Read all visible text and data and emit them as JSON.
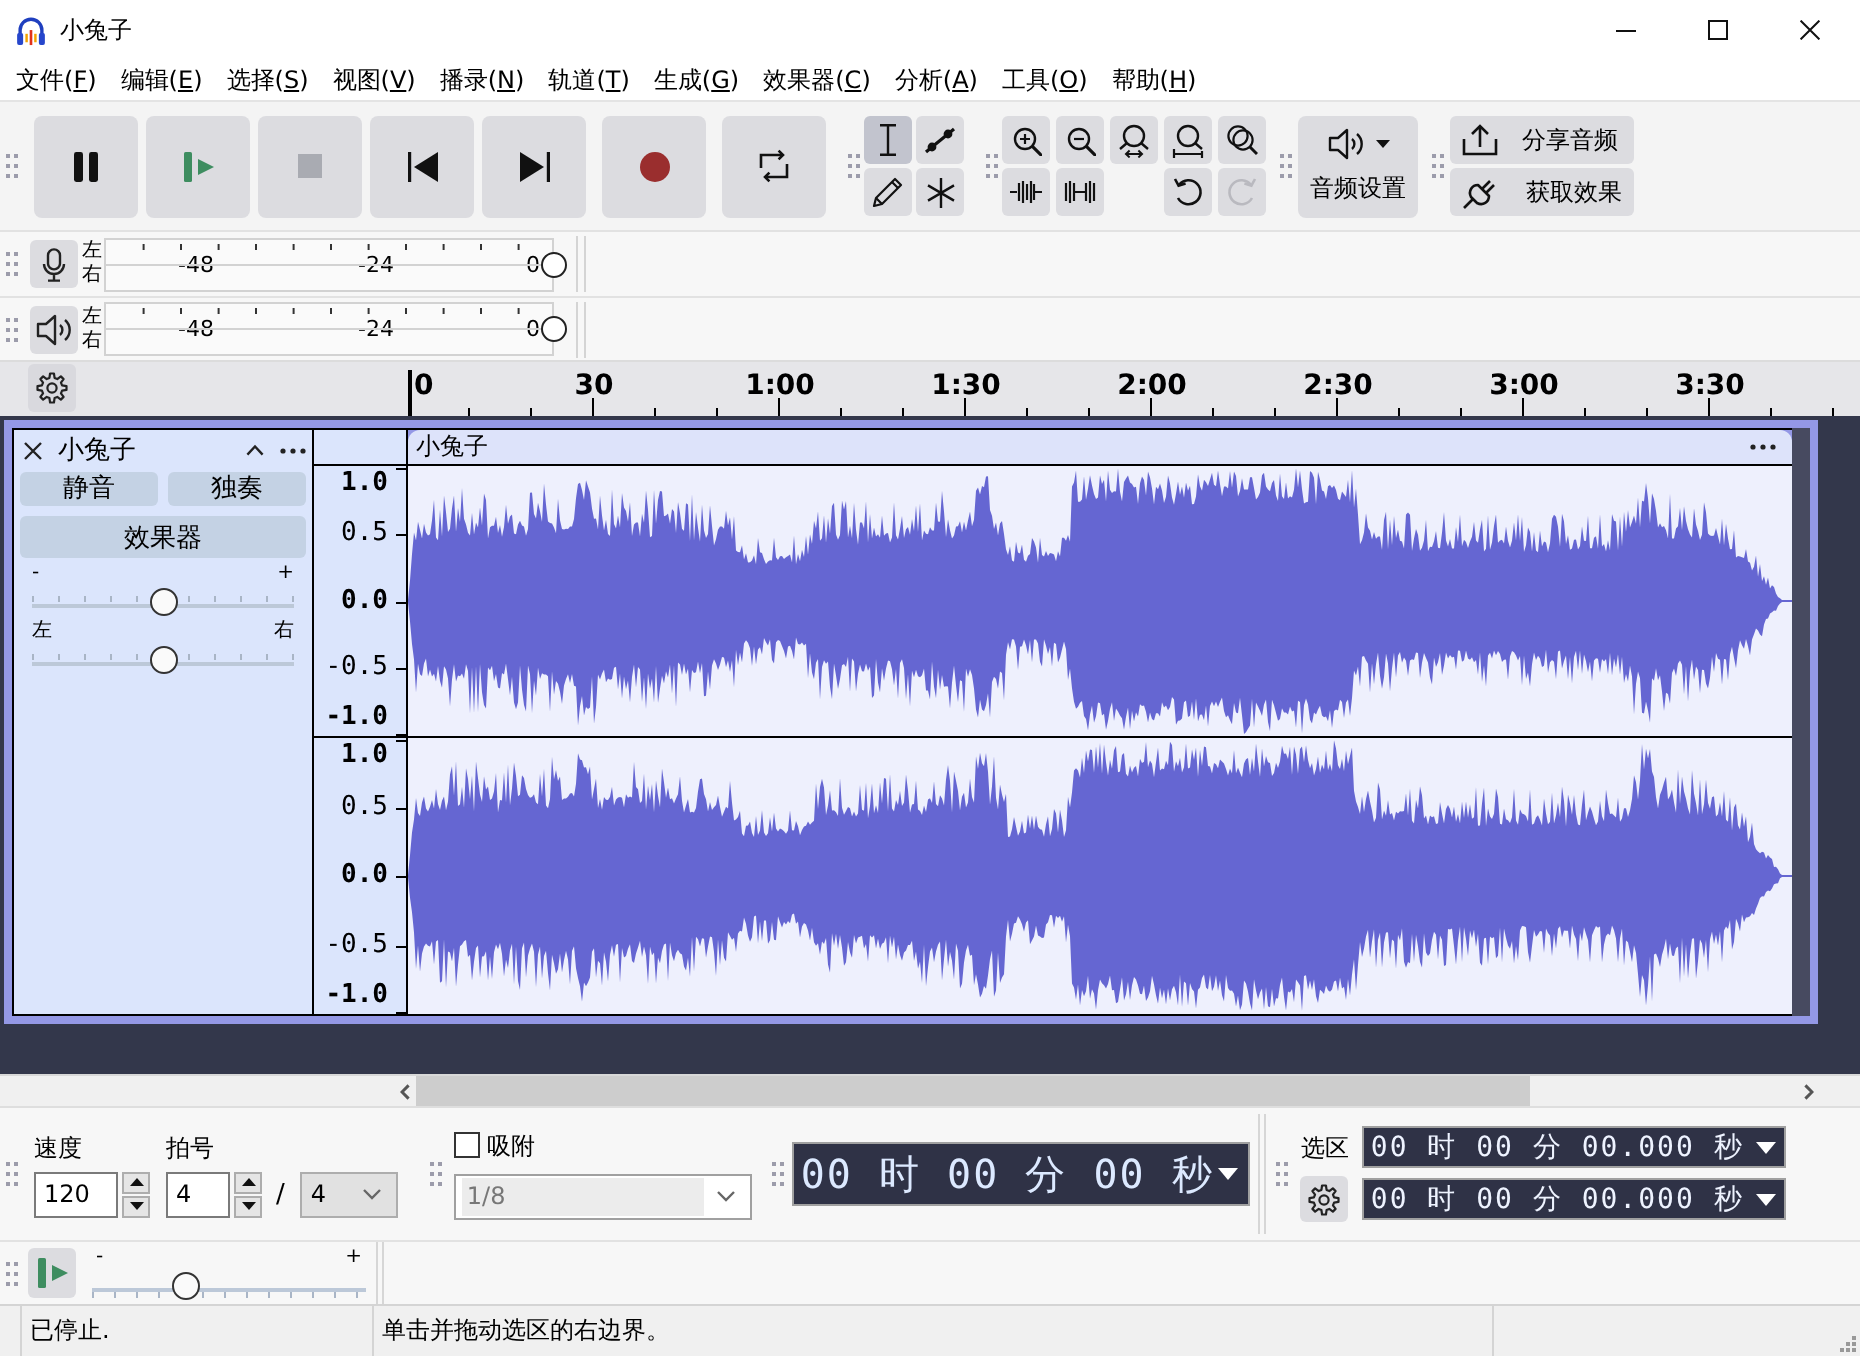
{
  "window": {
    "title": "小兔子"
  },
  "menu": [
    "文件(F)",
    "编辑(E)",
    "选择(S)",
    "视图(V)",
    "播录(N)",
    "轨道(T)",
    "生成(G)",
    "效果器(C)",
    "分析(A)",
    "工具(O)",
    "帮助(H)"
  ],
  "transport": [
    {
      "kind": "pause",
      "disabled": false
    },
    {
      "kind": "play",
      "disabled": false
    },
    {
      "kind": "stop",
      "disabled": true
    },
    {
      "kind": "skip_to_start",
      "disabled": false
    },
    {
      "kind": "skip_to_end",
      "disabled": false
    },
    {
      "kind": "record",
      "disabled": false
    },
    {
      "kind": "loop",
      "disabled": false
    }
  ],
  "tools": [
    {
      "kind": "select",
      "selected": true
    },
    {
      "kind": "envelope",
      "selected": false
    },
    {
      "kind": "draw",
      "selected": false
    },
    {
      "kind": "multi",
      "selected": false
    }
  ],
  "edit_tools": [
    {
      "kind": "zoom_in",
      "disabled": false
    },
    {
      "kind": "zoom_out",
      "disabled": false
    },
    {
      "kind": "fit_selection",
      "disabled": false
    },
    {
      "kind": "fit_project",
      "disabled": false
    },
    {
      "kind": "zoom_toggle",
      "disabled": false
    },
    {
      "kind": "trim",
      "disabled": false
    },
    {
      "kind": "silence",
      "disabled": false
    },
    {
      "kind": "undo",
      "disabled": false
    },
    {
      "kind": "redo",
      "disabled": true
    }
  ],
  "audio_setup": {
    "label": "音频设置"
  },
  "share": [
    {
      "kind": "share",
      "label": "分享音频"
    },
    {
      "kind": "effects",
      "label": "获取效果"
    }
  ],
  "meters": [
    {
      "kind": "record",
      "channels": [
        "左",
        "右"
      ],
      "scale": [
        "-48",
        "-24",
        "0"
      ],
      "level": 1
    },
    {
      "kind": "playback",
      "channels": [
        "左",
        "右"
      ],
      "scale": [
        "-48",
        "-24",
        "0"
      ],
      "level": 1
    }
  ],
  "timeline": {
    "ticks": [
      "0",
      "30",
      "1:00",
      "1:30",
      "2:00",
      "2:30",
      "3:00",
      "3:30"
    ]
  },
  "track": {
    "name": "小兔子",
    "selected": true,
    "buttons": [
      {
        "label": "静音",
        "on": false
      },
      {
        "label": "独奏",
        "on": false
      }
    ],
    "effects": "效果器",
    "gain": {
      "min": "-",
      "max": "+",
      "level": 0.5
    },
    "pan": {
      "left": "左",
      "right": "右",
      "level": 0.5
    },
    "clip": {
      "name": "小兔子"
    },
    "channels": [
      {
        "scale": [
          "1.0",
          "0.5",
          "0.0",
          "-0.5",
          "-1.0"
        ]
      },
      {
        "scale": [
          "1.0",
          "0.5",
          "0.0",
          "-0.5",
          "-1.0"
        ]
      }
    ]
  },
  "tempo": {
    "label": "速度",
    "value": "120"
  },
  "time_signature": {
    "label": "拍号",
    "upper": "4",
    "separator": "/",
    "lower": "4"
  },
  "snap": {
    "label": "吸附",
    "checked": false,
    "value": "1/8",
    "disabled": true
  },
  "time": {
    "value": "00 时 00 分 00 秒"
  },
  "selection": {
    "label": "选区",
    "start": "00 时 00 分 00.000 秒",
    "end": "00 时 00 分 00.000 秒"
  },
  "play_at_speed": {
    "min": "-",
    "max": "+",
    "level": 0.34
  },
  "status_bar": [
    "已停止.",
    "单击并拖动选区的右边界。"
  ]
}
